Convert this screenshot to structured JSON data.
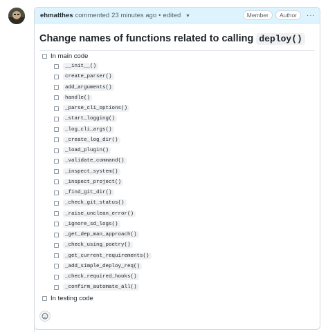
{
  "comment": {
    "author": "ehmatthes",
    "action": "commented",
    "time": "23 minutes ago",
    "separator": "•",
    "edited": "edited",
    "badges": [
      "Member",
      "Author"
    ],
    "more_menu": "···"
  },
  "issue": {
    "title_prefix": "Change names of functions related to calling ",
    "title_code": "deploy()"
  },
  "tasks": {
    "main_label": "In main code",
    "main_items": [
      "__init__()",
      "create_parser()",
      "add_arguments()",
      "handle()",
      "_parse_cli_options()",
      "_start_logging()",
      "_log_cli_args()",
      "_create_log_dir()",
      "_load_plugin()",
      "_validate_command()",
      "_inspect_system()",
      "_inspect_project()",
      "_find_git_dir()",
      "_check_git_status()",
      "_raise_unclean_error()",
      "_ignore_sd_logs()",
      "_get_dep_man_approach()",
      "_check_using_poetry()",
      "_get_current_requirements()",
      "_add_simple_deploy_req()",
      "_check_required_hooks()",
      "_confirm_automate_all()"
    ],
    "testing_label": "In testing code"
  },
  "icons": {
    "caret": "chevron-down-icon",
    "reaction": "smiley-icon"
  }
}
